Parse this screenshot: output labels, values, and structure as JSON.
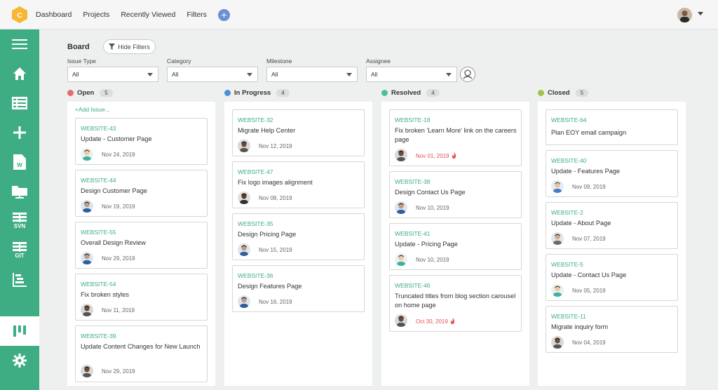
{
  "topnav": [
    "Dashboard",
    "Projects",
    "Recently Viewed",
    "Filters"
  ],
  "add_button": "+",
  "sidebar": [
    {
      "icon": "menu-icon",
      "label": ""
    },
    {
      "icon": "home-icon",
      "label": ""
    },
    {
      "icon": "table-icon",
      "label": ""
    },
    {
      "icon": "plus-icon",
      "label": ""
    },
    {
      "icon": "wiki-icon",
      "label": ""
    },
    {
      "icon": "folder-icon",
      "label": ""
    },
    {
      "icon": "svn-icon",
      "label": "SVN"
    },
    {
      "icon": "git-icon",
      "label": "GIT"
    },
    {
      "icon": "gantt-icon",
      "label": ""
    },
    {
      "icon": "board-icon",
      "label": "",
      "active": true
    },
    {
      "icon": "gear-icon",
      "label": ""
    }
  ],
  "board": {
    "title": "Board",
    "hide_filters": "Hide Filters"
  },
  "filters": [
    {
      "label": "Issue Type",
      "value": "All"
    },
    {
      "label": "Category",
      "value": "All"
    },
    {
      "label": "Milestone",
      "value": "All"
    },
    {
      "label": "Assignee",
      "value": "All"
    }
  ],
  "colors": {
    "accent": "#3ead83",
    "open": "#e86c6c",
    "in_progress": "#4a8fd8",
    "resolved": "#4bbf9b",
    "closed": "#a3c24a",
    "overdue": "#e94c4c"
  },
  "columns": [
    {
      "name": "Open",
      "count": "5",
      "color": "#e86c6c",
      "add_issue": "+Add Issue...",
      "cards": [
        {
          "id": "WEBSITE-43",
          "title": "Update - Customer Page",
          "date": "Nov 24, 2019",
          "avatar": "female"
        },
        {
          "id": "WEBSITE-44",
          "title": "Design Customer Page",
          "date": "Nov 19, 2019",
          "avatar": "male-blue"
        },
        {
          "id": "WEBSITE-55",
          "title": "Overall Design Review",
          "date": "Nov 29, 2019",
          "avatar": "male-blue"
        },
        {
          "id": "WEBSITE-54",
          "title": "Fix broken styles",
          "date": "Nov 11, 2019",
          "avatar": "male-dark"
        },
        {
          "id": "WEBSITE-39",
          "title": "Update Content Changes for New Launch",
          "date": "Nov 29, 2019",
          "avatar": "male-dark"
        }
      ]
    },
    {
      "name": "In Progress",
      "count": "4",
      "color": "#4a8fd8",
      "cards": [
        {
          "id": "WEBSITE-32",
          "title": "Migrate Help Center",
          "date": "Nov 12, 2019",
          "avatar": "male-dark"
        },
        {
          "id": "WEBSITE-47",
          "title": "Fix logo images alignment",
          "date": "Nov 08, 2019",
          "avatar": "male-dark2"
        },
        {
          "id": "WEBSITE-35",
          "title": "Design Pricing Page",
          "date": "Nov 15, 2019",
          "avatar": "male-blue"
        },
        {
          "id": "WEBSITE-36",
          "title": "Design Features Page",
          "date": "Nov 16, 2019",
          "avatar": "male-blue"
        }
      ]
    },
    {
      "name": "Resolved",
      "count": "4",
      "color": "#4bbf9b",
      "cards": [
        {
          "id": "WEBSITE-18",
          "title": "Fix broken 'Learn More' link on the careers page",
          "date": "Nov 01, 2019",
          "avatar": "male-dark",
          "overdue": true
        },
        {
          "id": "WEBSITE-38",
          "title": "Design Contact Us Page",
          "date": "Nov 10, 2019",
          "avatar": "male-blue"
        },
        {
          "id": "WEBSITE-41",
          "title": "Update - Pricing Page",
          "date": "Nov 10, 2019",
          "avatar": "female"
        },
        {
          "id": "WEBSITE-46",
          "title": "Truncated titles from blog section carousel on home page",
          "date": "Oct 30, 2019",
          "avatar": "male-dark",
          "overdue": true
        }
      ]
    },
    {
      "name": "Closed",
      "count": "5",
      "color": "#a3c24a",
      "cards": [
        {
          "id": "WEBSITE-64",
          "title": "Plan EOY email campaign",
          "date": "",
          "avatar": ""
        },
        {
          "id": "WEBSITE-40",
          "title": "Update - Features Page",
          "date": "Nov 09, 2019",
          "avatar": "male-light"
        },
        {
          "id": "WEBSITE-2",
          "title": "Update - About Page",
          "date": "Nov 07, 2019",
          "avatar": "male-glasses"
        },
        {
          "id": "WEBSITE-5",
          "title": "Update - Contact Us Page",
          "date": "Nov 05, 2019",
          "avatar": "female"
        },
        {
          "id": "WEBSITE-11",
          "title": "Migrate inquiry form",
          "date": "Nov 04, 2019",
          "avatar": "male-dark"
        }
      ]
    }
  ]
}
